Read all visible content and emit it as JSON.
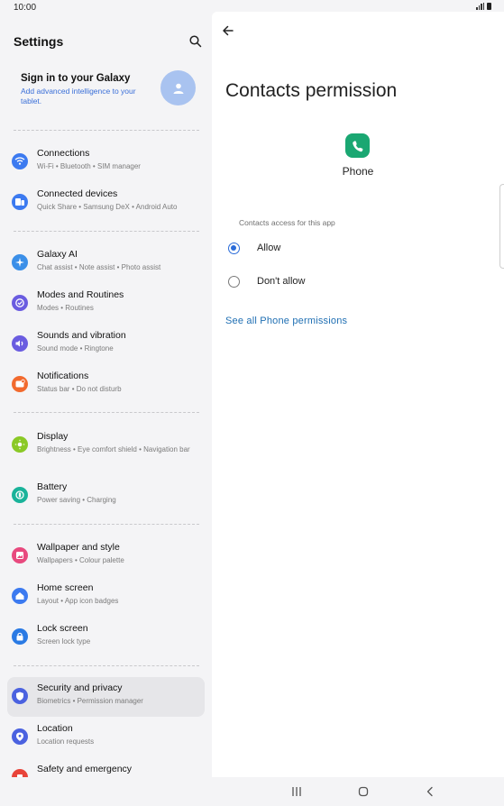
{
  "status": {
    "time": "10:00"
  },
  "left": {
    "title": "Settings",
    "account": {
      "title": "Sign in to your Galaxy",
      "subtitle": "Add advanced intelligence to your tablet."
    },
    "items": [
      {
        "label": "Connections",
        "sub": "Wi-Fi  •  Bluetooth  •  SIM manager",
        "color": "#3c7af0",
        "icon": "wifi-icon"
      },
      {
        "label": "Connected devices",
        "sub": "Quick Share  •  Samsung DeX  •  Android Auto",
        "color": "#3c7af0",
        "icon": "devices-icon"
      },
      {
        "label": "Galaxy AI",
        "sub": "Chat assist  •  Note assist  •  Photo assist",
        "color": "#3b8fe8",
        "icon": "sparkle-icon"
      },
      {
        "label": "Modes and Routines",
        "sub": "Modes  •  Routines",
        "color": "#6a5ce0",
        "icon": "check-circle-icon"
      },
      {
        "label": "Sounds and vibration",
        "sub": "Sound mode  •  Ringtone",
        "color": "#6a5ce0",
        "icon": "volume-icon"
      },
      {
        "label": "Notifications",
        "sub": "Status bar  •  Do not disturb",
        "color": "#f26a2e",
        "icon": "notification-icon"
      },
      {
        "label": "Display",
        "sub": "Brightness  •  Eye comfort shield  •  Navigation bar",
        "color": "#8ac926",
        "icon": "sun-icon"
      },
      {
        "label": "Battery",
        "sub": "Power saving  •  Charging",
        "color": "#1ab39a",
        "icon": "battery-icon"
      },
      {
        "label": "Wallpaper and style",
        "sub": "Wallpapers  •  Colour palette",
        "color": "#e8497e",
        "icon": "wallpaper-icon"
      },
      {
        "label": "Home screen",
        "sub": "Layout  •  App icon badges",
        "color": "#3c7af0",
        "icon": "home-icon"
      },
      {
        "label": "Lock screen",
        "sub": "Screen lock type",
        "color": "#2a7ae4",
        "icon": "lock-icon"
      },
      {
        "label": "Security and privacy",
        "sub": "Biometrics  •  Permission manager",
        "color": "#4b62e0",
        "icon": "shield-icon"
      },
      {
        "label": "Location",
        "sub": "Location requests",
        "color": "#4b62e0",
        "icon": "location-icon"
      },
      {
        "label": "Safety and emergency",
        "sub": "",
        "color": "#e8443a",
        "icon": "emergency-icon"
      }
    ]
  },
  "right": {
    "title": "Contacts permission",
    "app_name": "Phone",
    "section_label": "Contacts access for this app",
    "options": [
      {
        "label": "Allow",
        "selected": true
      },
      {
        "label": "Don't allow",
        "selected": false
      }
    ],
    "link": "See all Phone permissions"
  },
  "colors": {
    "accent": "#2b6cd9",
    "link": "#1f6fb3",
    "phone_green": "#1aa772"
  }
}
